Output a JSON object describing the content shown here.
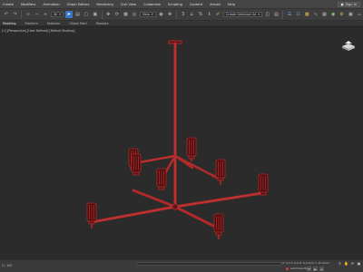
{
  "menu": {
    "items": [
      "Create",
      "Modifiers",
      "Animation",
      "Graph Editors",
      "Rendering",
      "Civil View",
      "Customize",
      "Scripting",
      "Content",
      "Arnold",
      "Help"
    ],
    "signin_label": "Sign In"
  },
  "toolbar": {
    "selection_filter": "All",
    "reference_coord": "View",
    "selection_set": "Create Selection Se"
  },
  "ribbon": {
    "tabs": [
      "Modeling",
      "Freeform",
      "Selection",
      "Object Paint",
      "Populate"
    ]
  },
  "viewport": {
    "label": "[+] [Perspective] [User Defined] [Default Shading]"
  },
  "status": {
    "left_text": "0 / 100",
    "coords": "X: 0.0   Y: 0.0   Z: 0.0   Grid = 10.0mm",
    "add_time_tag": "Add Time Tag"
  },
  "colors": {
    "model_stroke": "#b02a2a",
    "model_fill": "#5a1414",
    "active_tool": "#3b76c4",
    "viewport_bg": "#2b2b2b"
  }
}
